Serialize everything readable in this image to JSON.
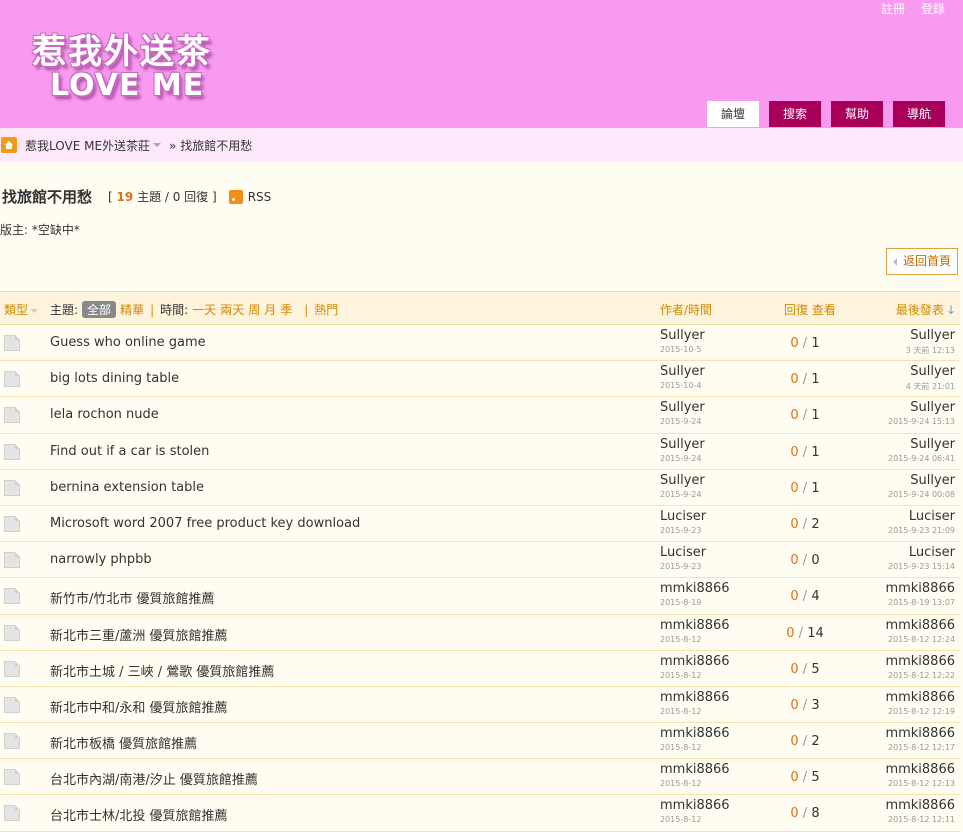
{
  "header": {
    "register": "註冊",
    "login": "登錄",
    "logo_cn": "惹我外送茶",
    "logo_en": "LOVE ME"
  },
  "nav": [
    {
      "label": "論壇",
      "active": true
    },
    {
      "label": "搜索",
      "active": false
    },
    {
      "label": "幫助",
      "active": false
    },
    {
      "label": "導航",
      "active": false
    }
  ],
  "breadcrumb": {
    "site": "惹我LOVE ME外送茶莊",
    "current": "» 找旅館不用愁"
  },
  "forum": {
    "title": "找旅館不用愁",
    "stats_open": "[",
    "topics_count": "19",
    "topics_label": "主題 / 0 回復 ]",
    "rss": "RSS",
    "moderator": "版主: *空缺中*",
    "back_home": "返回首頁"
  },
  "table_header": {
    "type": "類型",
    "topic_label": "主題:",
    "all": "全部",
    "digest": "精華",
    "time_label": "時間:",
    "times": [
      "一天",
      "兩天",
      "周",
      "月",
      "季"
    ],
    "hot": "熱門",
    "author_time": "作者/時間",
    "replies_views": "回復 查看",
    "last_post": "最後發表"
  },
  "threads": [
    {
      "title": "Guess who online game",
      "author": "Sullyer",
      "date": "2015-10-5",
      "replies": "0",
      "views": "1",
      "last_user": "Sullyer",
      "last_time": "3 天前 12:13"
    },
    {
      "title": "big lots dining table",
      "author": "Sullyer",
      "date": "2015-10-4",
      "replies": "0",
      "views": "1",
      "last_user": "Sullyer",
      "last_time": "4 天前 21:01"
    },
    {
      "title": "lela rochon nude",
      "author": "Sullyer",
      "date": "2015-9-24",
      "replies": "0",
      "views": "1",
      "last_user": "Sullyer",
      "last_time": "2015-9-24 15:13"
    },
    {
      "title": "Find out if a car is stolen",
      "author": "Sullyer",
      "date": "2015-9-24",
      "replies": "0",
      "views": "1",
      "last_user": "Sullyer",
      "last_time": "2015-9-24 06:41"
    },
    {
      "title": "bernina extension table",
      "author": "Sullyer",
      "date": "2015-9-24",
      "replies": "0",
      "views": "1",
      "last_user": "Sullyer",
      "last_time": "2015-9-24 00:08"
    },
    {
      "title": "Microsoft word 2007 free product key download",
      "author": "Luciser",
      "date": "2015-9-23",
      "replies": "0",
      "views": "2",
      "last_user": "Luciser",
      "last_time": "2015-9-23 21:09"
    },
    {
      "title": "narrowly phpbb",
      "author": "Luciser",
      "date": "2015-9-23",
      "replies": "0",
      "views": "0",
      "last_user": "Luciser",
      "last_time": "2015-9-23 15:14"
    },
    {
      "title": "新竹市/竹北市 優質旅館推薦",
      "author": "mmki8866",
      "date": "2015-8-19",
      "replies": "0",
      "views": "4",
      "last_user": "mmki8866",
      "last_time": "2015-8-19 13:07"
    },
    {
      "title": "新北市三重/蘆洲 優質旅館推薦",
      "author": "mmki8866",
      "date": "2015-8-12",
      "replies": "0",
      "views": "14",
      "last_user": "mmki8866",
      "last_time": "2015-8-12 12:24"
    },
    {
      "title": "新北市土城 / 三峽 / 鶯歌 優質旅館推薦",
      "author": "mmki8866",
      "date": "2015-8-12",
      "replies": "0",
      "views": "5",
      "last_user": "mmki8866",
      "last_time": "2015-8-12 12:22"
    },
    {
      "title": "新北市中和/永和 優質旅館推薦",
      "author": "mmki8866",
      "date": "2015-8-12",
      "replies": "0",
      "views": "3",
      "last_user": "mmki8866",
      "last_time": "2015-8-12 12:19"
    },
    {
      "title": "新北市板橋 優質旅館推薦",
      "author": "mmki8866",
      "date": "2015-8-12",
      "replies": "0",
      "views": "2",
      "last_user": "mmki8866",
      "last_time": "2015-8-12 12:17"
    },
    {
      "title": "台北市內湖/南港/汐止 優質旅館推薦",
      "author": "mmki8866",
      "date": "2015-8-12",
      "replies": "0",
      "views": "5",
      "last_user": "mmki8866",
      "last_time": "2015-8-12 12:13"
    },
    {
      "title": "台北市士林/北投 優質旅館推薦",
      "author": "mmki8866",
      "date": "2015-8-12",
      "replies": "0",
      "views": "8",
      "last_user": "mmki8866",
      "last_time": "2015-8-12 12:11"
    }
  ]
}
